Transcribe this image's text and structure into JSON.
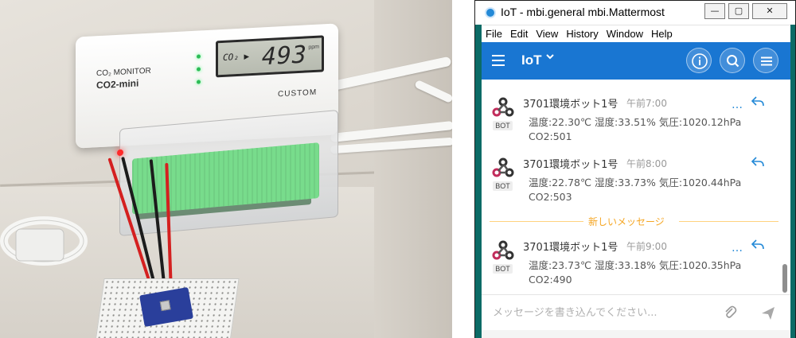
{
  "photo": {
    "co2_monitor": {
      "brand_line1": "CO₂ MONITOR",
      "brand_line2": "CO2-mini",
      "lcd_label": "CO₂ ▶",
      "lcd_value": "493",
      "lcd_unit": "ppm",
      "maker": "CUSTOM"
    }
  },
  "window": {
    "title": "IoT - mbi.general mbi.Mattermost",
    "controls": {
      "minimize": "—",
      "maximize": "▢",
      "close": "✕"
    },
    "menu": [
      "File",
      "Edit",
      "View",
      "History",
      "Window",
      "Help"
    ]
  },
  "header": {
    "channel": "IoT",
    "chevron": "⌄",
    "buttons": [
      "info-icon",
      "search-icon",
      "menu-icon"
    ]
  },
  "posts": [
    {
      "user": "3701環境ボット1号",
      "time": "午前7:00",
      "line1": "温度:22.30℃ 湿度:33.51% 気圧:1020.12hPa",
      "line2": "CO2:501",
      "badge": "BOT",
      "dots": "…"
    },
    {
      "user": "3701環境ボット1号",
      "time": "午前8:00",
      "line1": "温度:22.78℃ 湿度:33.73% 気圧:1020.44hPa",
      "line2": "CO2:503",
      "badge": "BOT",
      "dots": "…"
    },
    {
      "user": "3701環境ボット1号",
      "time": "午前9:00",
      "line1": "温度:23.73℃ 湿度:33.18% 気圧:1020.35hPa",
      "line2": "CO2:490",
      "badge": "BOT",
      "dots": "…"
    }
  ],
  "new_messages_separator": "新しいメッセージ",
  "composer": {
    "placeholder": "メッセージを書き込んでください..."
  },
  "colors": {
    "header": "#1976d2",
    "accent": "#2389d7",
    "new_msg": "#f5a623",
    "frame": "#0c6b66"
  }
}
